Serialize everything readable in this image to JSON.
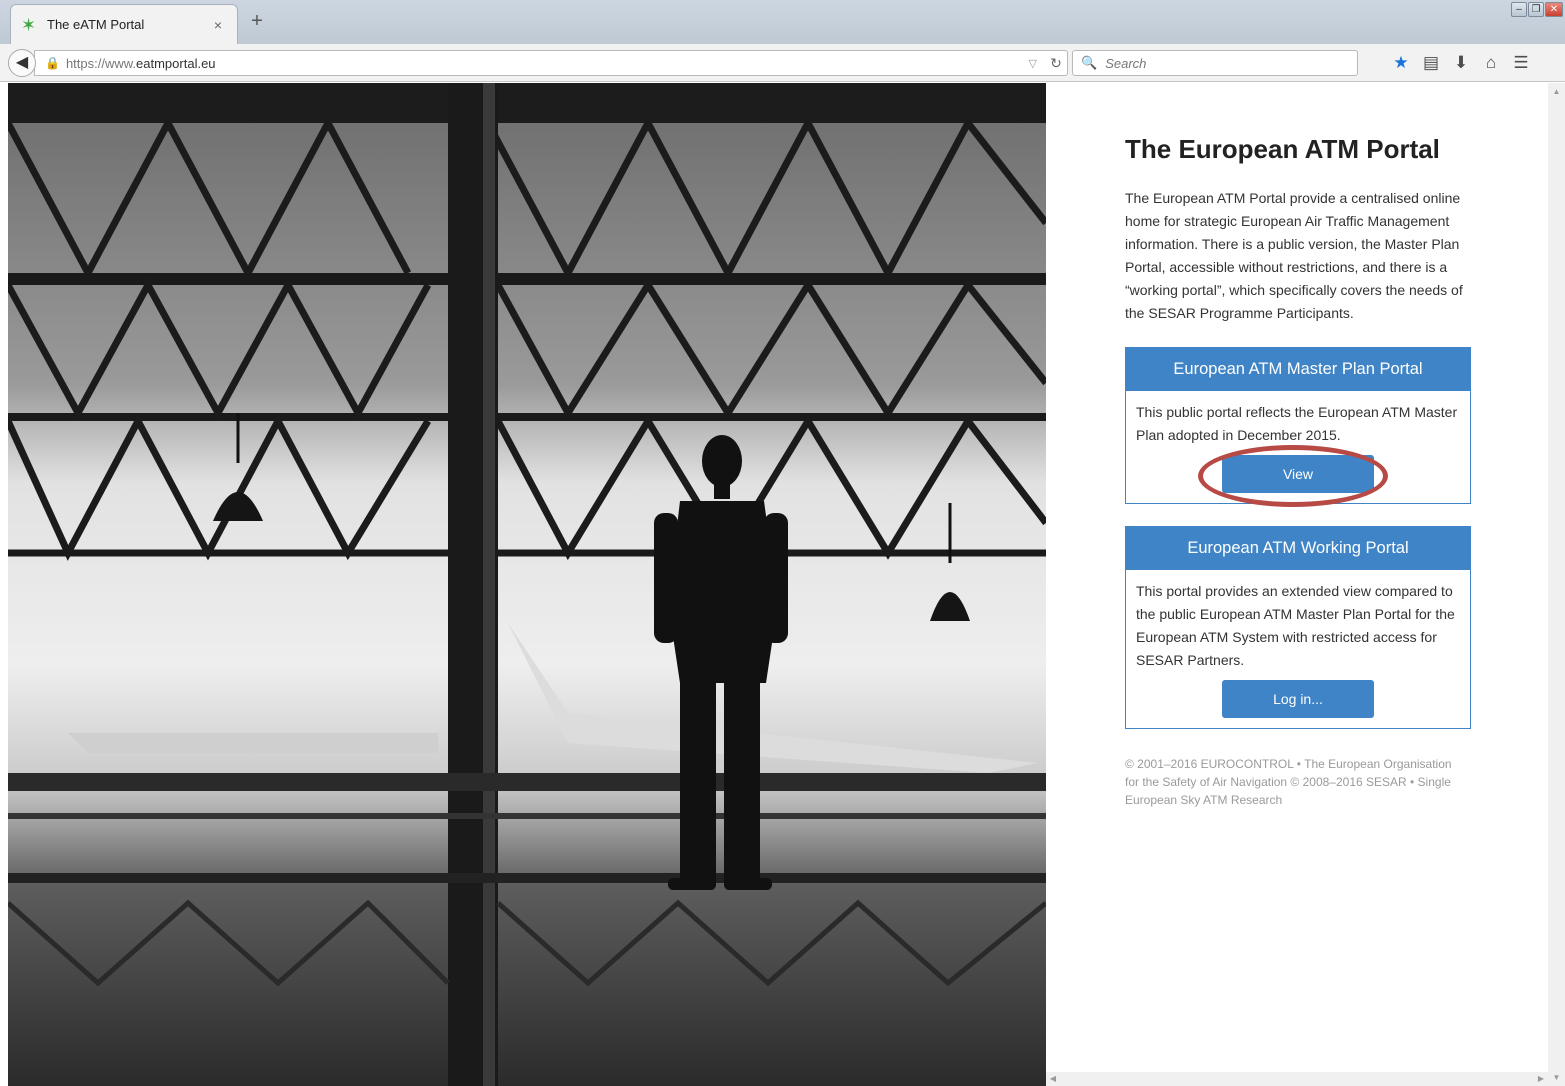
{
  "browser": {
    "tab": {
      "title": "The eATM Portal",
      "favicon": "star-leaf-icon",
      "close": "×"
    },
    "new_tab": "+",
    "url": {
      "scheme": "https://www.",
      "domain": "eatmportal.eu"
    },
    "search": {
      "placeholder": "Search"
    }
  },
  "page": {
    "title": "The European ATM Portal",
    "intro": "The European ATM Portal provide a centralised online home for strategic European Air Traffic Management information. There is a public version, the Master Plan Portal, accessible without restrictions, and there is a “working portal”, which specifically covers the needs of the SESAR Programme Participants.",
    "cards": [
      {
        "header": "European ATM Master Plan Portal",
        "body": "This public portal reflects the European ATM Master Plan adopted in December 2015.",
        "button": "View"
      },
      {
        "header": "European ATM Working Portal",
        "body": "This portal provides an extended view compared to the public European ATM Master Plan Portal for the European ATM System with restricted access for SESAR Partners.",
        "button": "Log in..."
      }
    ],
    "footer": "© 2001–2016 EUROCONTROL • The European Organisation for the Safety of Air Navigation © 2008–2016 SESAR • Single European Sky ATM Research"
  },
  "colors": {
    "accent": "#3f84c6",
    "highlight_ring": "#b84a46",
    "footer_text": "#9a9a9a"
  }
}
